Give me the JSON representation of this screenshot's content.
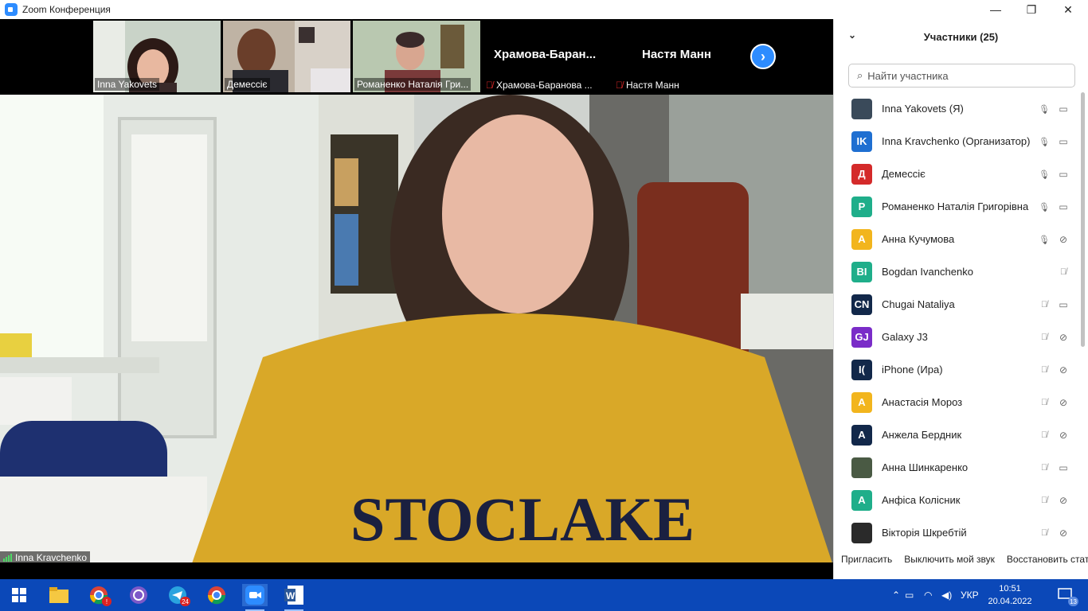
{
  "window": {
    "title": "Zoom Конференция",
    "minimize": "—",
    "maximize": "❐",
    "close": "✕"
  },
  "strip": {
    "thumbnails": [
      {
        "name": "Inna Yakovets"
      },
      {
        "name": "Демессіє"
      },
      {
        "name": "Романенко Наталія Гри..."
      }
    ],
    "tiles": [
      {
        "title": "Храмова-Баран...",
        "label": "Храмова-Баранова ..."
      },
      {
        "title": "Настя Манн",
        "label": "Настя Манн"
      }
    ],
    "next_icon": "chevron-right-icon"
  },
  "main_video": {
    "name": "Inna Kravchenko"
  },
  "panel": {
    "title": "Участники (25)",
    "search_placeholder": "Найти участника",
    "participants": [
      {
        "initials": "",
        "name": "Inna Yakovets (Я)",
        "color": "#3a4a5a",
        "mic": "on",
        "video": "on",
        "photo": true
      },
      {
        "initials": "IK",
        "name": "Inna Kravchenko (Организатор)",
        "color": "#1f6fd1",
        "mic": "on",
        "video": "on"
      },
      {
        "initials": "Д",
        "name": "Демессіє",
        "color": "#d42a2a",
        "mic": "on",
        "video": "on"
      },
      {
        "initials": "Р",
        "name": "Романенко Наталія Григорівна",
        "color": "#1fae8a",
        "mic": "on",
        "video": "on"
      },
      {
        "initials": "А",
        "name": "Анна Кучумова",
        "color": "#f2b51d",
        "mic": "on",
        "video": "off"
      },
      {
        "initials": "BI",
        "name": "Bogdan Ivanchenko",
        "color": "#1fae8a",
        "mic": "off",
        "video": "none"
      },
      {
        "initials": "CN",
        "name": "Chugai Nataliya",
        "color": "#12284a",
        "mic": "off",
        "video": "on"
      },
      {
        "initials": "GJ",
        "name": "Galaxy J3",
        "color": "#7a2cc8",
        "mic": "off",
        "video": "off"
      },
      {
        "initials": "I(",
        "name": "iPhone (Ира)",
        "color": "#12284a",
        "mic": "off",
        "video": "off"
      },
      {
        "initials": "А",
        "name": "Анастасія Мороз",
        "color": "#f2b51d",
        "mic": "off",
        "video": "off"
      },
      {
        "initials": "А",
        "name": "Анжела Бердник",
        "color": "#12284a",
        "mic": "off",
        "video": "off"
      },
      {
        "initials": "",
        "name": "Анна Шинкаренко",
        "color": "#4a5a44",
        "mic": "off",
        "video": "on",
        "photo": true
      },
      {
        "initials": "А",
        "name": "Анфіса Колісник",
        "color": "#1fae8a",
        "mic": "off",
        "video": "off"
      },
      {
        "initials": "",
        "name": "Вікторія Шкребтій",
        "color": "#2a2a2a",
        "mic": "off",
        "video": "off",
        "photo": true
      }
    ],
    "footer": {
      "invite": "Пригласить",
      "mute_me": "Выключить мой звук",
      "restore": "Восстановить стат"
    }
  },
  "taskbar": {
    "apps": [
      {
        "name": "start-button",
        "icon": "windows-icon"
      },
      {
        "name": "file-explorer",
        "icon": "folder-icon"
      },
      {
        "name": "chrome",
        "icon": "chrome-icon",
        "badge": ""
      },
      {
        "name": "viber",
        "icon": "viber-icon"
      },
      {
        "name": "telegram",
        "icon": "telegram-icon",
        "badge": "24"
      },
      {
        "name": "chrome-profile",
        "icon": "chrome-icon"
      },
      {
        "name": "zoom",
        "icon": "zoom-icon"
      },
      {
        "name": "word",
        "icon": "word-icon"
      }
    ],
    "language": "УКР",
    "time": "10:51",
    "date": "20.04.2022",
    "notifications": "13"
  }
}
